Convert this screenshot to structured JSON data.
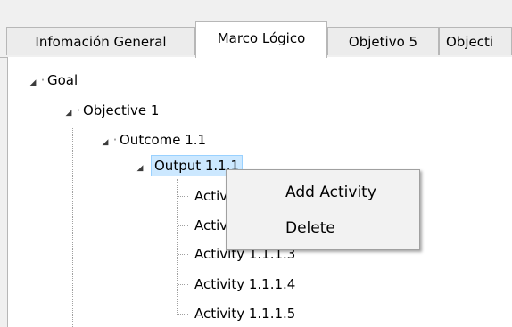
{
  "tabs": [
    {
      "label": "Infomación General",
      "active": false
    },
    {
      "label": "Marco Lógico",
      "active": true
    },
    {
      "label": "Objetivo 5",
      "active": false
    },
    {
      "label": "Objecti",
      "active": false
    }
  ],
  "tree": {
    "goal": "Goal",
    "objective": "Objective 1",
    "outcome": "Outcome 1.1",
    "output": "Output 1.1.1",
    "activities": [
      "Activity 1.1.1.1",
      "Activity 1.1.1.2",
      "Activity 1.1.1.3",
      "Activity 1.1.1.4",
      "Activity 1.1.1.5"
    ]
  },
  "context_menu": {
    "items": [
      "Add Activity",
      "Delete"
    ]
  },
  "colors": {
    "selection_bg": "#cce8ff",
    "selection_border": "#99d1ff",
    "menu_bg": "#f2f2f2"
  }
}
